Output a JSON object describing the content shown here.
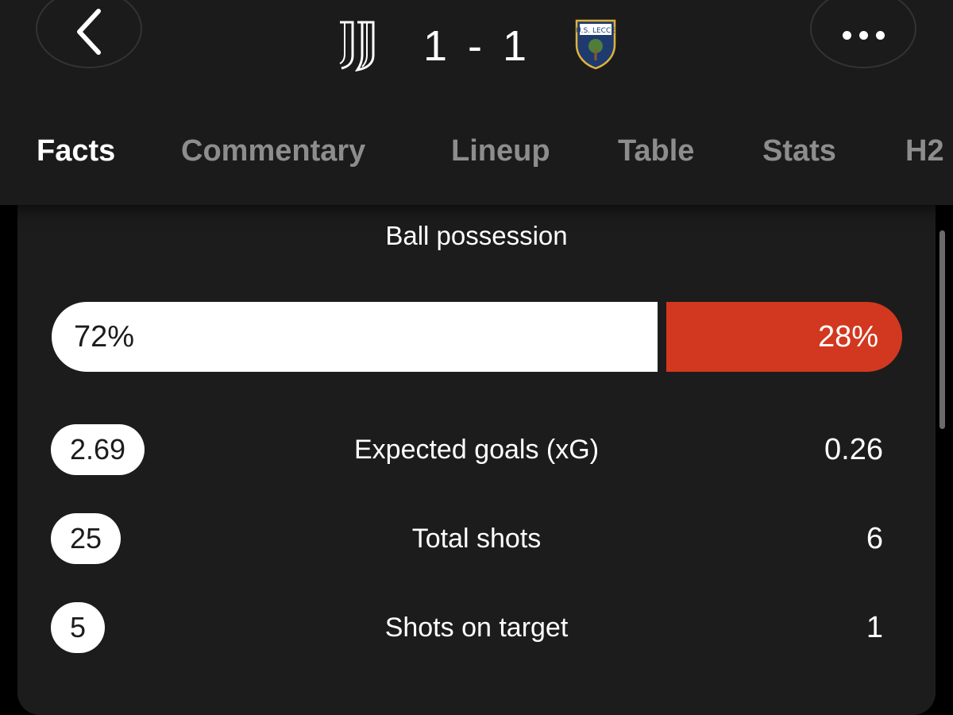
{
  "match": {
    "home_score": "1",
    "separator": "-",
    "away_score": "1",
    "home_team_icon": "juventus-crest",
    "away_team_icon": "lecce-crest",
    "away_crest_text": "U.S. LECCE"
  },
  "tabs": [
    {
      "label": "Facts",
      "active": true
    },
    {
      "label": "Commentary",
      "active": false
    },
    {
      "label": "Lineup",
      "active": false
    },
    {
      "label": "Table",
      "active": false
    },
    {
      "label": "Stats",
      "active": false
    },
    {
      "label": "H2",
      "active": false
    }
  ],
  "possession": {
    "title": "Ball possession",
    "home_label": "72%",
    "away_label": "28%",
    "home_value": 72,
    "away_value": 28,
    "home_color": "#ffffff",
    "away_color": "#d2381f"
  },
  "stats": [
    {
      "label": "Expected goals (xG)",
      "home": "2.69",
      "away": "0.26"
    },
    {
      "label": "Total shots",
      "home": "25",
      "away": "6"
    },
    {
      "label": "Shots on target",
      "home": "5",
      "away": "1"
    }
  ],
  "colors": {
    "background": "#000000",
    "card": "#1c1c1c",
    "header": "#1b1b1b",
    "tab_inactive": "#8d8d8d",
    "accent_away": "#d2381f"
  }
}
